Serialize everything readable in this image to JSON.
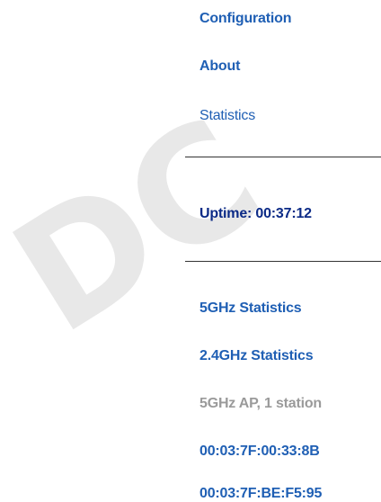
{
  "watermark": {
    "text": "DC"
  },
  "nav": {
    "configuration": "Configuration",
    "about": "About",
    "statistics": "Statistics"
  },
  "status": {
    "uptime": "Uptime: 00:37:12"
  },
  "stats": {
    "ghz5": "5GHz Statistics",
    "ghz24": "2.4GHz Statistics",
    "ap_summary": "5GHz AP, 1 station",
    "stations": [
      "00:03:7F:00:33:8B",
      "00:03:7F:BE:F5:95"
    ]
  },
  "colors": {
    "link": "#1f5fb4",
    "dark": "#0b2a86",
    "muted": "#9a9a9a",
    "watermark": "#e8e8e8"
  }
}
